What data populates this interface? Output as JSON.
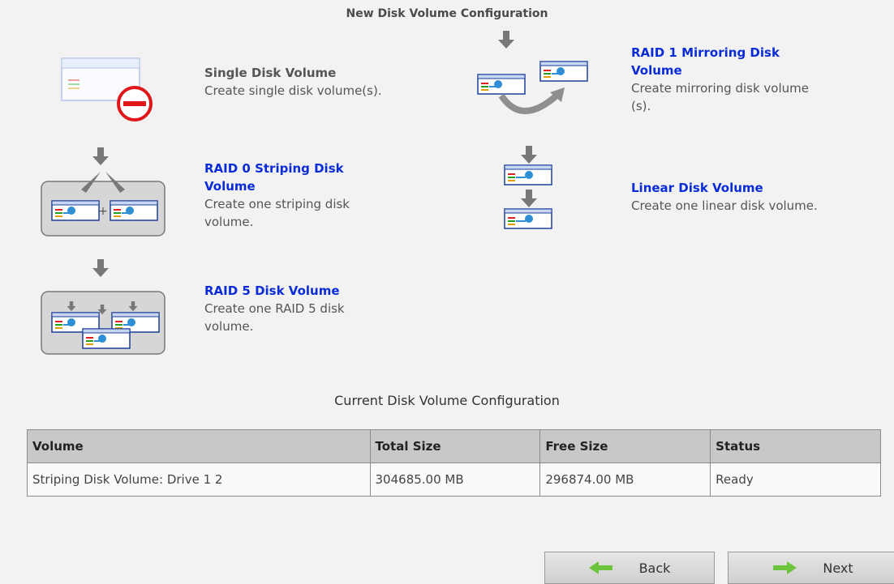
{
  "new_section": {
    "title": "New Disk Volume Configuration"
  },
  "options": {
    "single": {
      "label": "Single Disk Volume",
      "desc": "Create single disk volume(s)."
    },
    "raid1": {
      "label_line1": "RAID 1 Mirroring Disk",
      "label_line2": "Volume",
      "desc_line1": "Create mirroring disk volume",
      "desc_line2": "(s)."
    },
    "raid0": {
      "label_line1": "RAID 0 Striping Disk",
      "label_line2": "Volume",
      "desc_line1": "Create one striping disk",
      "desc_line2": "volume."
    },
    "linear": {
      "label": "Linear Disk Volume",
      "desc": "Create one linear disk volume."
    },
    "raid5": {
      "label": "RAID 5 Disk Volume",
      "desc_line1": "Create one RAID 5 disk",
      "desc_line2": "volume."
    }
  },
  "current_section": {
    "title": "Current Disk Volume Configuration",
    "columns": [
      "Volume",
      "Total Size",
      "Free Size",
      "Status"
    ],
    "rows": [
      [
        "Striping Disk Volume: Drive 1 2",
        "304685.00 MB",
        "296874.00 MB",
        "Ready"
      ]
    ]
  },
  "buttons": {
    "back": "Back",
    "next": "Next"
  },
  "colors": {
    "link": "#0a2bd8",
    "accent_arrow": "#6cc43c",
    "disk_badge": "#2f8fd6",
    "forbidden": "#e0161b"
  },
  "icons": [
    "disk-single-icon",
    "no-entry-icon",
    "raid1-mirror-icon",
    "raid0-stripe-icon",
    "linear-disk-icon",
    "raid5-icon",
    "arrow-left-icon",
    "arrow-right-icon"
  ]
}
